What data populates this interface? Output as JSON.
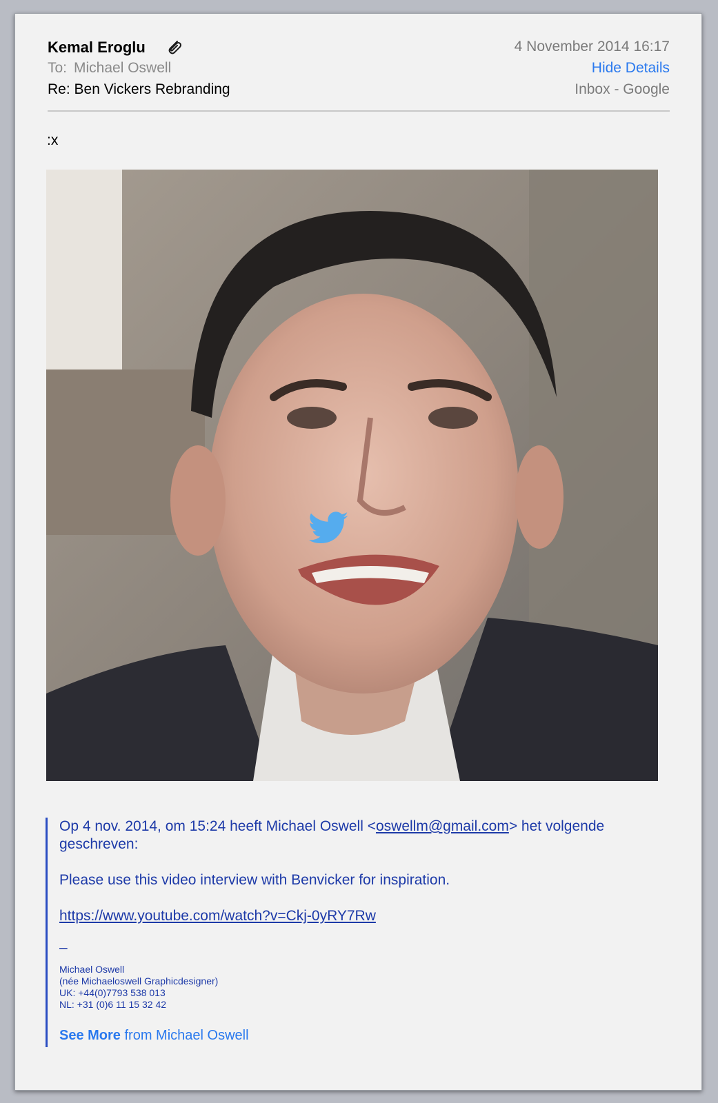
{
  "header": {
    "sender": "Kemal Eroglu",
    "to_label": "To:",
    "to_name": "Michael Oswell",
    "subject": "Re: Ben Vickers Rebranding",
    "date": "4 November 2014 16:17",
    "hide_details": "Hide Details",
    "mailbox": "Inbox - Google"
  },
  "body": {
    "text": ":x"
  },
  "icons": {
    "attachment": "paperclip-icon",
    "overlay": "twitter-bird-icon"
  },
  "quote": {
    "intro_before": "Op 4 nov. 2014, om 15:24 heeft Michael Oswell <",
    "email": "oswellm@gmail.com",
    "intro_after": "> het volgende",
    "intro_line2": "geschreven:",
    "message": "Please use this video interview with Benvicker for inspiration.",
    "url": "https://www.youtube.com/watch?v=Ckj-0yRY7Rw",
    "dash": "–",
    "signature": [
      "Michael Oswell",
      "(née Michaeloswell Graphicdesigner)",
      "UK: +44(0)7793 538 013",
      "NL: +31 (0)6 11 15 32 42"
    ],
    "see_more": "See More",
    "see_more_suffix": " from Michael Oswell"
  },
  "colors": {
    "link_blue": "#2a79ee",
    "quote_blue": "#1d3aa8",
    "quote_bar": "#2a4dc2",
    "twitter_blue": "#55acee"
  }
}
